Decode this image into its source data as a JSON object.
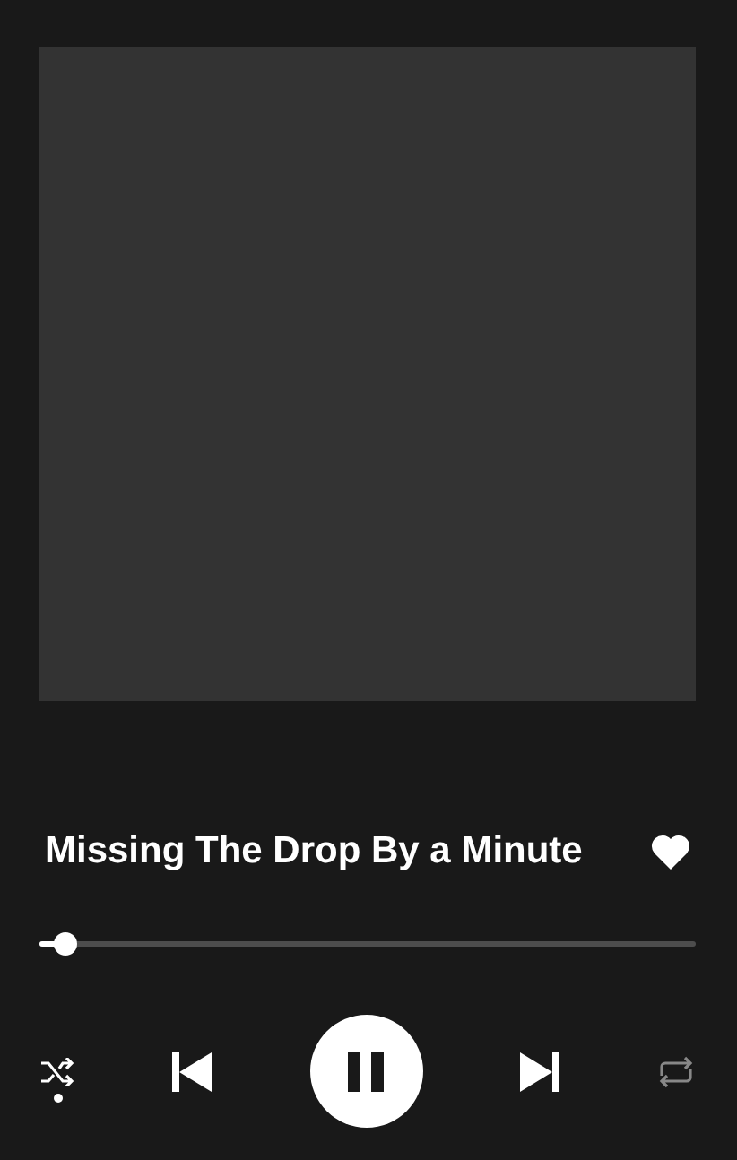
{
  "track": {
    "title": "Missing The Drop By a Minute",
    "liked": true
  },
  "progress": {
    "level": 0.02
  },
  "controls": {
    "shuffle": true,
    "playing": true,
    "repeat": false
  }
}
